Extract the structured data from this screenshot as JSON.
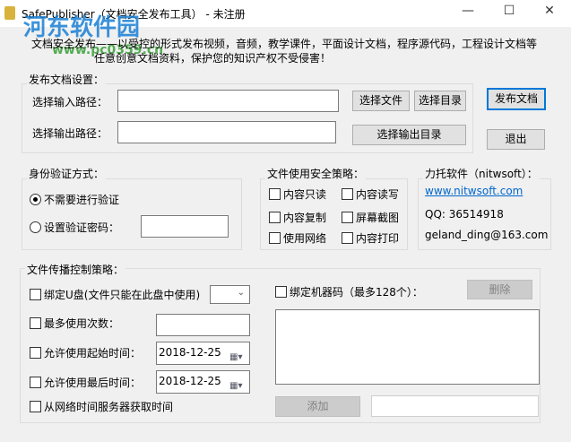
{
  "window": {
    "title": "SafePublisher（文档安全发布工具） - 未注册",
    "minimize": "—",
    "maximize": "☐",
    "close": "✕"
  },
  "watermark": {
    "text": "河东软件园",
    "url": "www.pc0359.cn"
  },
  "description": {
    "line1": "文档安全发布——以受控的形式发布视频，音频，教学课件，平面设计文档，程序源代码，工程设计文档等",
    "line2": "任意创意文档资料，保护您的知识产权不受侵害！"
  },
  "publish": {
    "label": "发布文档设置：",
    "input_label": "选择输入路径：",
    "output_label": "选择输出路径：",
    "input_value": "",
    "output_value": "",
    "select_file": "选择文件",
    "select_dir": "选择目录",
    "select_output_dir": "选择输出目录"
  },
  "actions": {
    "publish": "发布文档",
    "exit": "退出"
  },
  "auth": {
    "label": "身份验证方式：",
    "no_verify": "不需要进行验证",
    "set_password": "设置验证密码：",
    "password": ""
  },
  "security": {
    "label": "文件使用安全策略：",
    "items": [
      "内容只读",
      "内容读写",
      "内容复制",
      "屏幕截图",
      "使用网络",
      "内容打印"
    ]
  },
  "vendor": {
    "label": "力托软件（nitwsoft）：",
    "website": "www.nitwsoft.com",
    "qq": "QQ:  36514918",
    "email": "geland_ding@163.com"
  },
  "spread": {
    "label": "文件传播控制策略：",
    "bind_usb": "绑定U盘(文件只能在此盘中使用)",
    "usb_value": "",
    "max_uses": "最多使用次数：",
    "max_uses_value": "",
    "start_time": "允许使用起始时间：",
    "start_date": "2018-12-25",
    "end_time": "允许使用最后时间：",
    "end_date": "2018-12-25",
    "net_time": "从网络时间服务器获取时间",
    "bind_machine": "绑定机器码（最多128个）：",
    "delete": "删除",
    "add": "添加",
    "machine_code": ""
  }
}
